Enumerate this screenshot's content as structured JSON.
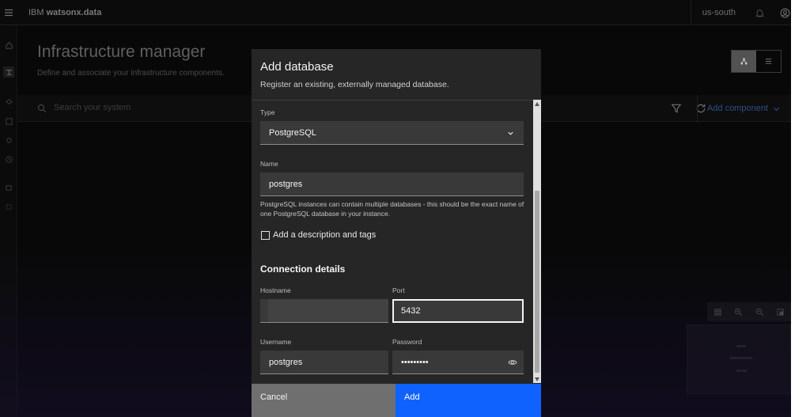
{
  "header": {
    "brand_prefix": "IBM",
    "brand_name": "watsonx.data",
    "region": "us-south"
  },
  "page": {
    "title": "Infrastructure manager",
    "subtitle": "Define and associate your infrastructure components.",
    "search_placeholder": "Search your system",
    "add_component": "Add component"
  },
  "modal": {
    "title": "Add database",
    "subtitle": "Register an existing, externally managed database.",
    "type_label": "Type",
    "type_value": "PostgreSQL",
    "name_label": "Name",
    "name_value": "postgres",
    "helper_text": "PostgreSQL instances can contain multiple databases - this should be the exact name of one PostgreSQL database in your instance.",
    "description_checkbox_label": "Add a description and tags",
    "description_checked": false,
    "section_heading": "Connection details",
    "hostname_label": "Hostname",
    "hostname_value": "",
    "port_label": "Port",
    "port_value": "5432",
    "username_label": "Username",
    "username_value": "postgres",
    "password_label": "Password",
    "password_value": "•••••••••",
    "cancel_label": "Cancel",
    "add_label": "Add"
  },
  "colors": {
    "primary_button": "#0f62fe",
    "secondary_button": "#6f6f6f",
    "modal_bg": "#262626",
    "field_bg": "#393939"
  },
  "icons": [
    "menu-icon",
    "notification-icon",
    "user-icon",
    "home-icon",
    "infrastructure-icon",
    "search-icon",
    "filter-icon",
    "refresh-icon",
    "chevron-down-icon",
    "topology-view-icon",
    "list-view-icon",
    "fit-icon",
    "zoom-in-icon",
    "zoom-out-icon",
    "minimap-icon",
    "view-password-icon"
  ]
}
